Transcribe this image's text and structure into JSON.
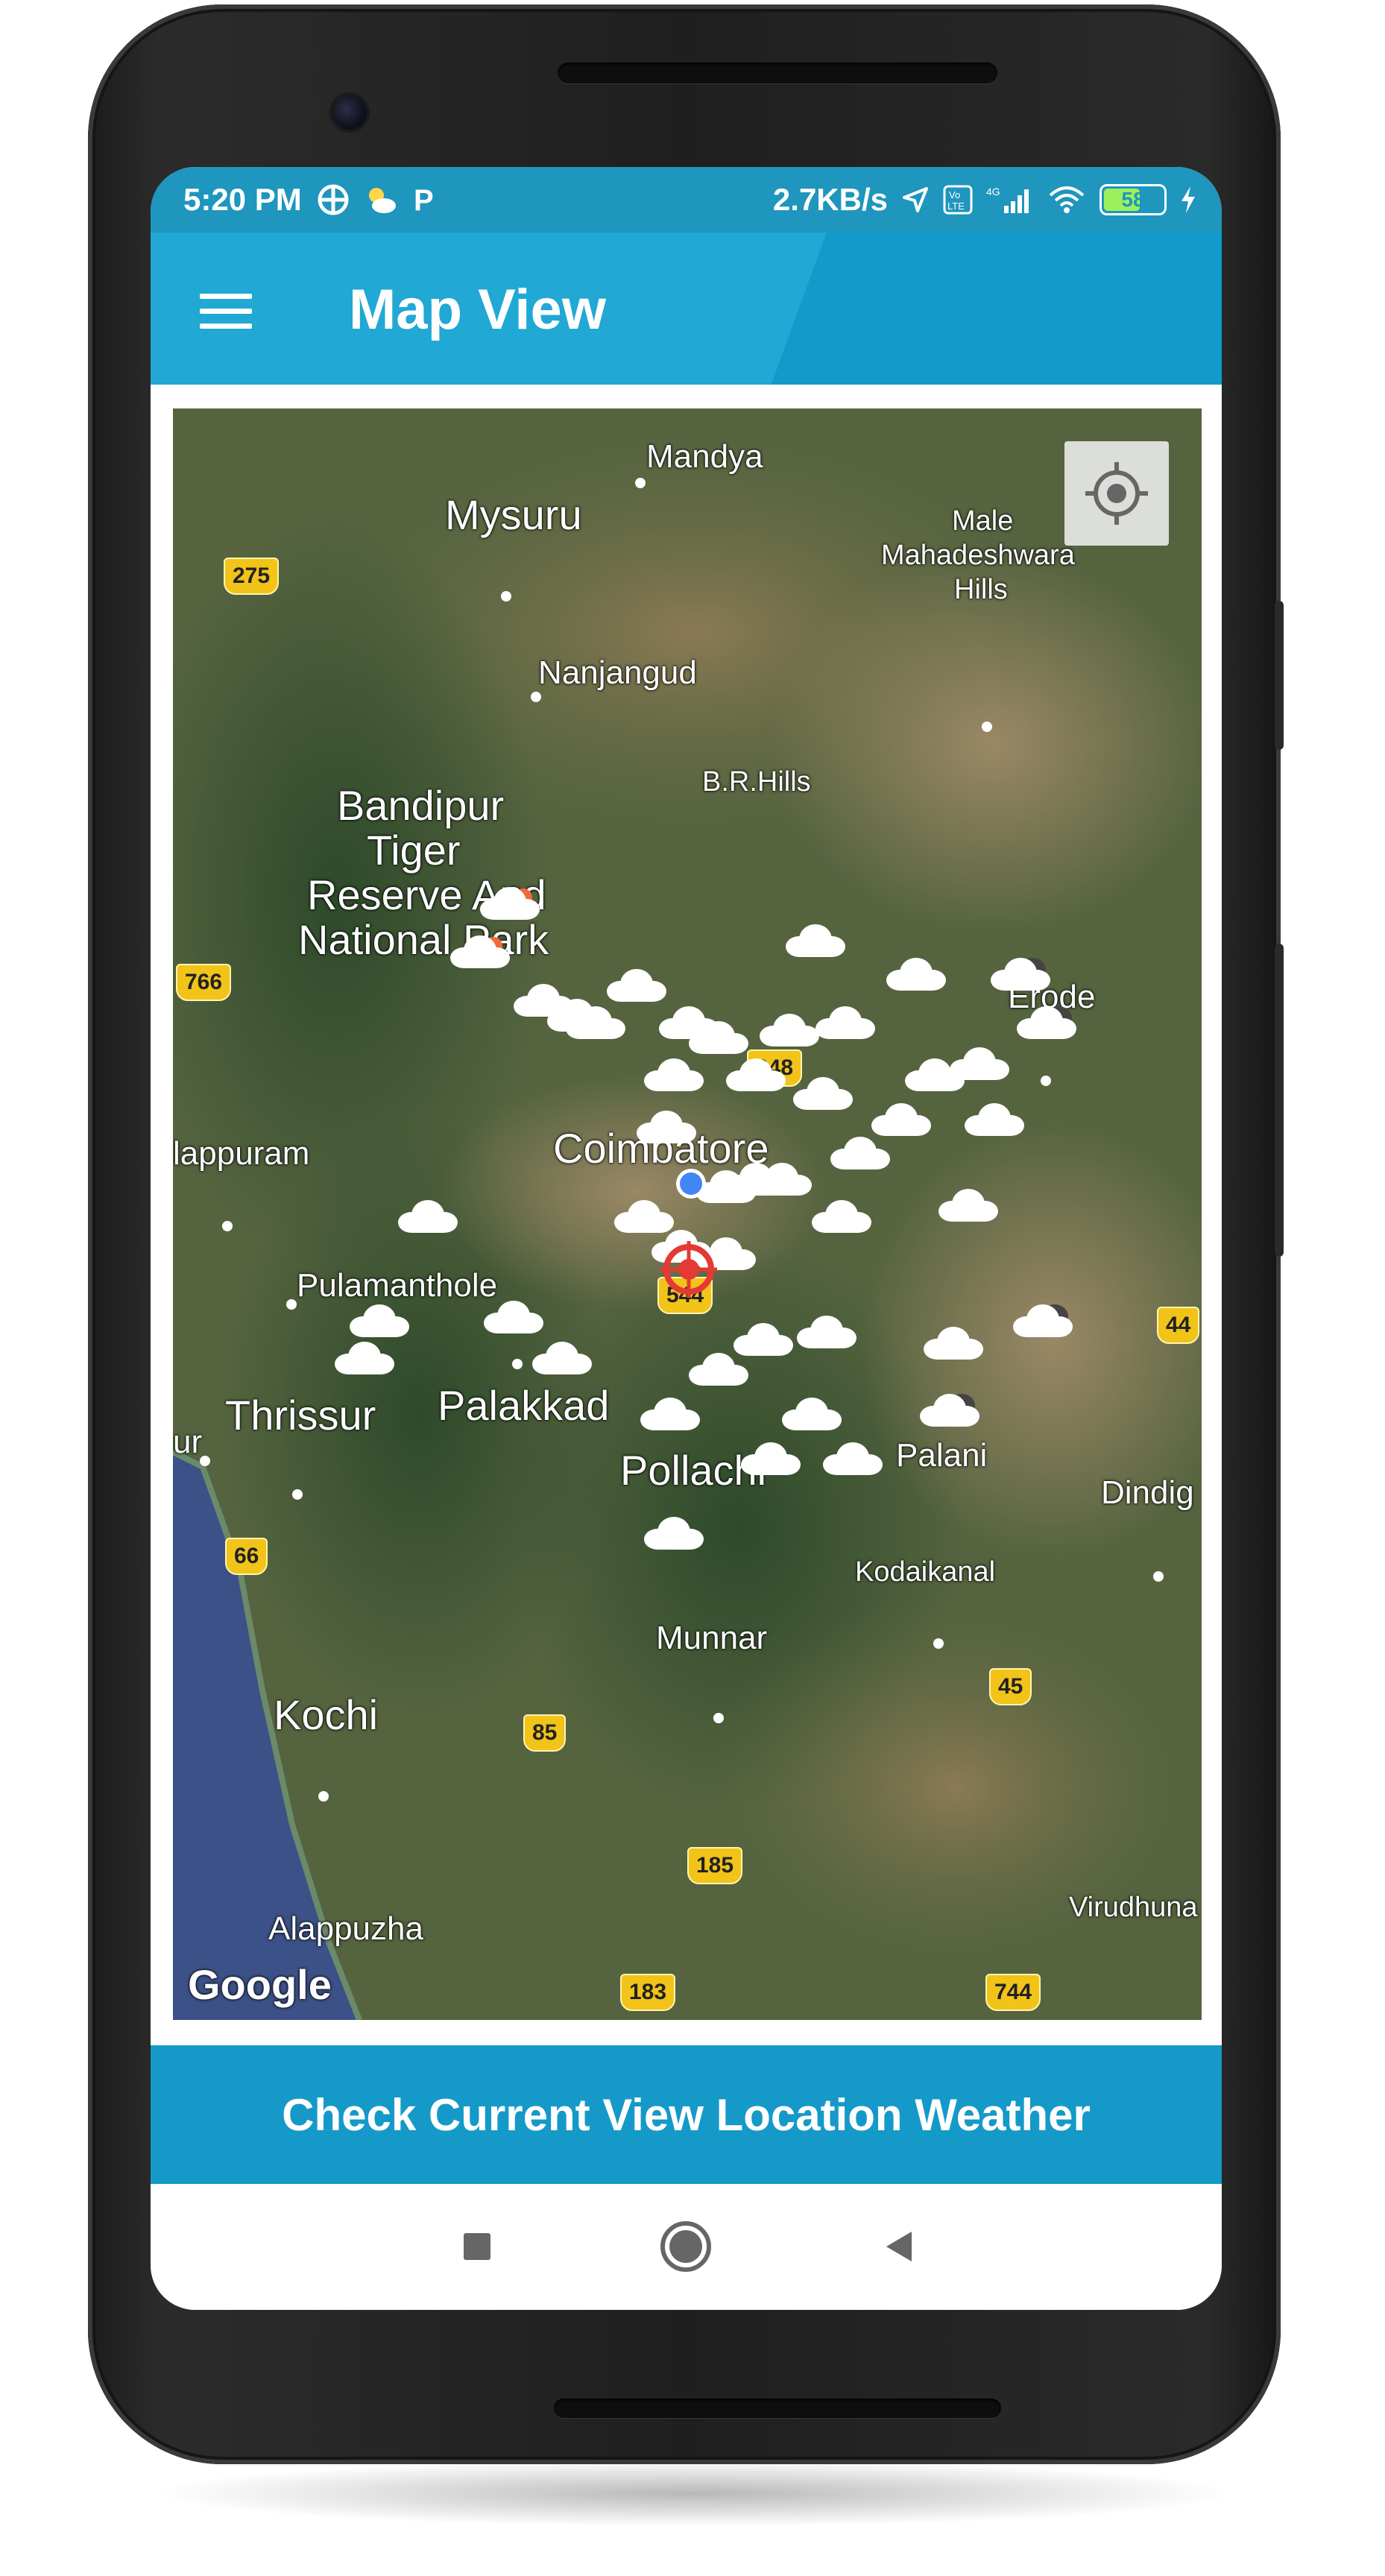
{
  "status_bar": {
    "time": "5:20 PM",
    "network_speed": "2.7KB/s",
    "battery_level": "58",
    "network_type": "4G",
    "volte": "Vo LTE"
  },
  "app_bar": {
    "title": "Map View",
    "menu_icon": "hamburger-menu-icon"
  },
  "map": {
    "attribution": "Google",
    "locate_icon": "my-location-icon",
    "place_labels": [
      {
        "text": "Mandya"
      },
      {
        "text": "Mysuru"
      },
      {
        "text": "Male"
      },
      {
        "text": "Mahadeshwara"
      },
      {
        "text": "Hills"
      },
      {
        "text": "Nanjangud"
      },
      {
        "text": "B.R.Hills"
      },
      {
        "text": "Bandipur"
      },
      {
        "text": "Tiger"
      },
      {
        "text": "Reserve And"
      },
      {
        "text": "National Park"
      },
      {
        "text": "Erode"
      },
      {
        "text": "Coimbatore"
      },
      {
        "text": "lappuram"
      },
      {
        "text": "Pulamanthole"
      },
      {
        "text": "Thrissur"
      },
      {
        "text": "Palakkad"
      },
      {
        "text": "ur"
      },
      {
        "text": "Pollachi"
      },
      {
        "text": "Palani"
      },
      {
        "text": "Dindig"
      },
      {
        "text": "Kodaikanal"
      },
      {
        "text": "Munnar"
      },
      {
        "text": "Kochi"
      },
      {
        "text": "Virudhuna"
      },
      {
        "text": "Alappuzha"
      }
    ],
    "road_shields": [
      "275",
      "766",
      "948",
      "544",
      "44",
      "66",
      "85",
      "45",
      "185",
      "183",
      "744"
    ]
  },
  "cta_button": {
    "label": "Check Current View Location Weather"
  },
  "nav_bar": {
    "recents_icon": "square-recents-icon",
    "home_icon": "circle-home-icon",
    "back_icon": "triangle-back-icon"
  }
}
